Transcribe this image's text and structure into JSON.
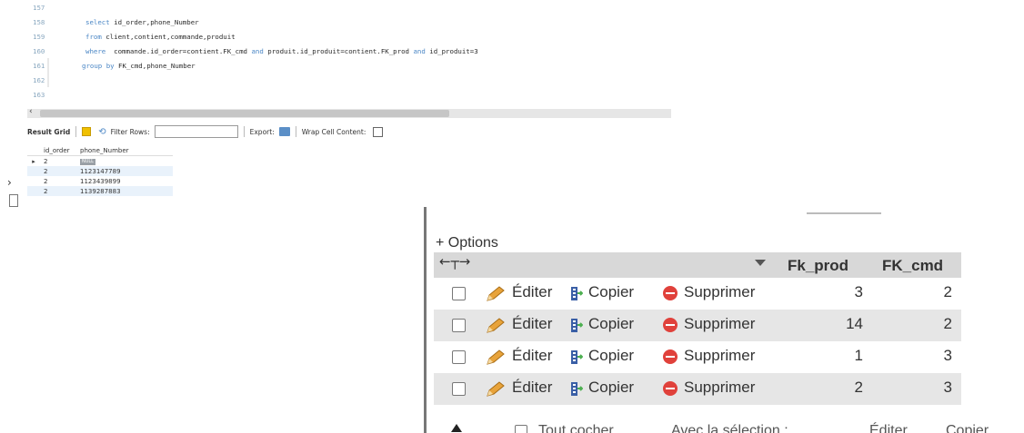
{
  "editor": {
    "lines": [
      {
        "num": "157",
        "text": ""
      },
      {
        "num": "158",
        "kw": "select",
        "text": " id_order,phone_Number"
      },
      {
        "num": "159",
        "kw": "from",
        "text": " client,contient,commande,produit"
      },
      {
        "num": "160",
        "kw": "where",
        "text": "  commande.id_order=contient.FK_cmd ",
        "kw2": "and",
        "text2": " produit.id_produit=contient.FK_prod ",
        "kw3": "and",
        "text3": " id_produit=3"
      },
      {
        "num": "161",
        "kw": "group by",
        "text": " FK_cmd,phone_Number"
      },
      {
        "num": "162",
        "text": ""
      },
      {
        "num": "163",
        "text": ""
      }
    ]
  },
  "result_toolbar": {
    "result_grid_label": "Result Grid",
    "filter_label": "Filter Rows:",
    "export_label": "Export:",
    "wrap_label": "Wrap Cell Content:"
  },
  "result_grid": {
    "columns": [
      "id_order",
      "phone_Number"
    ],
    "rows": [
      {
        "id_order": "2",
        "phone_Number": "NULL"
      },
      {
        "id_order": "2",
        "phone_Number": "1123147789"
      },
      {
        "id_order": "2",
        "phone_Number": "1123439899"
      },
      {
        "id_order": "2",
        "phone_Number": "1139287883"
      }
    ]
  },
  "pma": {
    "options_label": "+ Options",
    "columns": [
      "Fk_prod",
      "FK_cmd"
    ],
    "actions": {
      "edit": "Éditer",
      "copy": "Copier",
      "delete": "Supprimer"
    },
    "rows": [
      {
        "fk_prod": "3",
        "fk_cmd": "2"
      },
      {
        "fk_prod": "14",
        "fk_cmd": "2"
      },
      {
        "fk_prod": "1",
        "fk_cmd": "3"
      },
      {
        "fk_prod": "2",
        "fk_cmd": "3"
      }
    ],
    "footer": {
      "check_all": "Tout cocher",
      "with_selection": "Avec la sélection :",
      "edit": "Éditer",
      "copy": "Copier"
    }
  },
  "colors": {
    "delete_icon": "#e0413b",
    "pencil": "#e8a33a",
    "keyword": "#4a86c5",
    "header_bg": "#d8d8d8",
    "alt_row": "#e6e6e6"
  }
}
